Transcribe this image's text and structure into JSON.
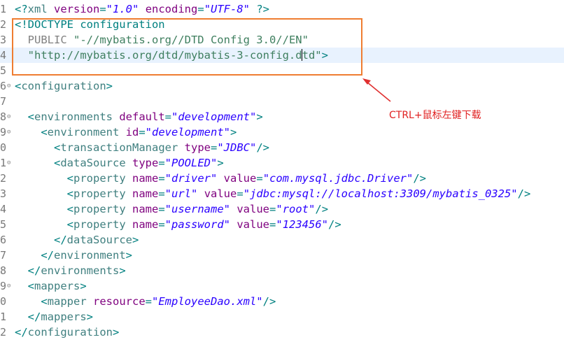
{
  "editor": {
    "lines": [
      {
        "num": "1",
        "fold": false,
        "current": false,
        "tokens": [
          {
            "c": "t-bracket",
            "t": "<?"
          },
          {
            "c": "t-tag",
            "t": "xml "
          },
          {
            "c": "t-attr",
            "t": "version"
          },
          {
            "c": "t-bracket",
            "t": "="
          },
          {
            "c": "t-val",
            "t": "\"1.0\""
          },
          {
            "c": "",
            "t": " "
          },
          {
            "c": "t-attr",
            "t": "encoding"
          },
          {
            "c": "t-bracket",
            "t": "="
          },
          {
            "c": "t-val",
            "t": "\"UTF-8\""
          },
          {
            "c": "t-bracket",
            "t": " ?>"
          }
        ]
      },
      {
        "num": "2",
        "fold": false,
        "current": false,
        "tokens": [
          {
            "c": "t-doctype",
            "t": "<!DOCTYPE configuration"
          }
        ]
      },
      {
        "num": "3",
        "fold": false,
        "current": false,
        "tokens": [
          {
            "c": "t-public",
            "t": "  PUBLIC "
          },
          {
            "c": "t-url",
            "t": "\"-//mybatis.org//DTD Config 3.0//EN\""
          }
        ]
      },
      {
        "num": "4",
        "fold": false,
        "current": true,
        "tokens": [
          {
            "c": "t-url",
            "t": "  \"http://mybatis.org/dtd/mybatis-3-config.d"
          },
          {
            "c": "caret",
            "t": ""
          },
          {
            "c": "t-url",
            "t": "td\""
          },
          {
            "c": "t-doctype",
            "t": ">"
          }
        ]
      },
      {
        "num": "5",
        "fold": false,
        "current": false,
        "tokens": []
      },
      {
        "num": "6",
        "fold": true,
        "current": false,
        "tokens": [
          {
            "c": "t-bracket",
            "t": "<"
          },
          {
            "c": "t-tag",
            "t": "configuration"
          },
          {
            "c": "t-bracket",
            "t": ">"
          }
        ]
      },
      {
        "num": "7",
        "fold": false,
        "current": false,
        "tokens": []
      },
      {
        "num": "8",
        "fold": true,
        "current": false,
        "tokens": [
          {
            "c": "",
            "t": "  "
          },
          {
            "c": "t-bracket",
            "t": "<"
          },
          {
            "c": "t-tag",
            "t": "environments "
          },
          {
            "c": "t-attr",
            "t": "default"
          },
          {
            "c": "t-bracket",
            "t": "="
          },
          {
            "c": "t-val",
            "t": "\"development\""
          },
          {
            "c": "t-bracket",
            "t": ">"
          }
        ]
      },
      {
        "num": "9",
        "fold": true,
        "current": false,
        "tokens": [
          {
            "c": "",
            "t": "    "
          },
          {
            "c": "t-bracket",
            "t": "<"
          },
          {
            "c": "t-tag",
            "t": "environment "
          },
          {
            "c": "t-attr",
            "t": "id"
          },
          {
            "c": "t-bracket",
            "t": "="
          },
          {
            "c": "t-val",
            "t": "\"development\""
          },
          {
            "c": "t-bracket",
            "t": ">"
          }
        ]
      },
      {
        "num": "0",
        "fold": false,
        "current": false,
        "tokens": [
          {
            "c": "",
            "t": "      "
          },
          {
            "c": "t-bracket",
            "t": "<"
          },
          {
            "c": "t-tag",
            "t": "transactionManager "
          },
          {
            "c": "t-attr",
            "t": "type"
          },
          {
            "c": "t-bracket",
            "t": "="
          },
          {
            "c": "t-val",
            "t": "\"JDBC\""
          },
          {
            "c": "t-bracket",
            "t": "/>"
          }
        ]
      },
      {
        "num": "1",
        "fold": true,
        "current": false,
        "tokens": [
          {
            "c": "",
            "t": "      "
          },
          {
            "c": "t-bracket",
            "t": "<"
          },
          {
            "c": "t-tag",
            "t": "dataSource "
          },
          {
            "c": "t-attr",
            "t": "type"
          },
          {
            "c": "t-bracket",
            "t": "="
          },
          {
            "c": "t-val",
            "t": "\"POOLED\""
          },
          {
            "c": "t-bracket",
            "t": ">"
          }
        ]
      },
      {
        "num": "2",
        "fold": false,
        "current": false,
        "tokens": [
          {
            "c": "",
            "t": "        "
          },
          {
            "c": "t-bracket",
            "t": "<"
          },
          {
            "c": "t-tag",
            "t": "property "
          },
          {
            "c": "t-attr",
            "t": "name"
          },
          {
            "c": "t-bracket",
            "t": "="
          },
          {
            "c": "t-val",
            "t": "\"driver\""
          },
          {
            "c": "",
            "t": " "
          },
          {
            "c": "t-attr",
            "t": "value"
          },
          {
            "c": "t-bracket",
            "t": "="
          },
          {
            "c": "t-val",
            "t": "\"com.mysql.jdbc.Driver\""
          },
          {
            "c": "t-bracket",
            "t": "/>"
          }
        ]
      },
      {
        "num": "3",
        "fold": false,
        "current": false,
        "tokens": [
          {
            "c": "",
            "t": "        "
          },
          {
            "c": "t-bracket",
            "t": "<"
          },
          {
            "c": "t-tag",
            "t": "property "
          },
          {
            "c": "t-attr",
            "t": "name"
          },
          {
            "c": "t-bracket",
            "t": "="
          },
          {
            "c": "t-val",
            "t": "\"url\""
          },
          {
            "c": "",
            "t": " "
          },
          {
            "c": "t-attr",
            "t": "value"
          },
          {
            "c": "t-bracket",
            "t": "="
          },
          {
            "c": "t-val",
            "t": "\"jdbc:mysql://localhost:3309/mybatis_0325\""
          },
          {
            "c": "t-bracket",
            "t": "/>"
          }
        ]
      },
      {
        "num": "4",
        "fold": false,
        "current": false,
        "tokens": [
          {
            "c": "",
            "t": "        "
          },
          {
            "c": "t-bracket",
            "t": "<"
          },
          {
            "c": "t-tag",
            "t": "property "
          },
          {
            "c": "t-attr",
            "t": "name"
          },
          {
            "c": "t-bracket",
            "t": "="
          },
          {
            "c": "t-val",
            "t": "\"username\""
          },
          {
            "c": "",
            "t": " "
          },
          {
            "c": "t-attr",
            "t": "value"
          },
          {
            "c": "t-bracket",
            "t": "="
          },
          {
            "c": "t-val",
            "t": "\"root\""
          },
          {
            "c": "t-bracket",
            "t": "/>"
          }
        ]
      },
      {
        "num": "5",
        "fold": false,
        "current": false,
        "tokens": [
          {
            "c": "",
            "t": "        "
          },
          {
            "c": "t-bracket",
            "t": "<"
          },
          {
            "c": "t-tag",
            "t": "property "
          },
          {
            "c": "t-attr",
            "t": "name"
          },
          {
            "c": "t-bracket",
            "t": "="
          },
          {
            "c": "t-val",
            "t": "\"password\""
          },
          {
            "c": "",
            "t": " "
          },
          {
            "c": "t-attr",
            "t": "value"
          },
          {
            "c": "t-bracket",
            "t": "="
          },
          {
            "c": "t-val",
            "t": "\"123456\""
          },
          {
            "c": "t-bracket",
            "t": "/>"
          }
        ]
      },
      {
        "num": "6",
        "fold": false,
        "current": false,
        "tokens": [
          {
            "c": "",
            "t": "      "
          },
          {
            "c": "t-bracket",
            "t": "</"
          },
          {
            "c": "t-tag",
            "t": "dataSource"
          },
          {
            "c": "t-bracket",
            "t": ">"
          }
        ]
      },
      {
        "num": "7",
        "fold": false,
        "current": false,
        "tokens": [
          {
            "c": "",
            "t": "    "
          },
          {
            "c": "t-bracket",
            "t": "</"
          },
          {
            "c": "t-tag",
            "t": "environment"
          },
          {
            "c": "t-bracket",
            "t": ">"
          }
        ]
      },
      {
        "num": "8",
        "fold": false,
        "current": false,
        "tokens": [
          {
            "c": "",
            "t": "  "
          },
          {
            "c": "t-bracket",
            "t": "</"
          },
          {
            "c": "t-tag",
            "t": "environments"
          },
          {
            "c": "t-bracket",
            "t": ">"
          }
        ]
      },
      {
        "num": "9",
        "fold": true,
        "current": false,
        "tokens": [
          {
            "c": "",
            "t": "  "
          },
          {
            "c": "t-bracket",
            "t": "<"
          },
          {
            "c": "t-tag",
            "t": "mappers"
          },
          {
            "c": "t-bracket",
            "t": ">"
          }
        ]
      },
      {
        "num": "0",
        "fold": false,
        "current": false,
        "tokens": [
          {
            "c": "",
            "t": "    "
          },
          {
            "c": "t-bracket",
            "t": "<"
          },
          {
            "c": "t-tag",
            "t": "mapper "
          },
          {
            "c": "t-attr",
            "t": "resource"
          },
          {
            "c": "t-bracket",
            "t": "="
          },
          {
            "c": "t-val",
            "t": "\"EmployeeDao.xml\""
          },
          {
            "c": "t-bracket",
            "t": "/>"
          }
        ]
      },
      {
        "num": "1",
        "fold": false,
        "current": false,
        "tokens": [
          {
            "c": "",
            "t": "  "
          },
          {
            "c": "t-bracket",
            "t": "</"
          },
          {
            "c": "t-tag",
            "t": "mappers"
          },
          {
            "c": "t-bracket",
            "t": ">"
          }
        ]
      },
      {
        "num": "2",
        "fold": false,
        "current": false,
        "tokens": [
          {
            "c": "t-bracket",
            "t": "</"
          },
          {
            "c": "t-tag",
            "t": "configuration"
          },
          {
            "c": "t-bracket",
            "t": ">"
          }
        ]
      }
    ]
  },
  "annotation": {
    "text": "CTRL+鼠标左键下载",
    "box_color": "#ef7d31",
    "arrow_color": "#e03030",
    "text_color": "#e02020"
  },
  "icons": {
    "fold": "fold-collapse-icon"
  }
}
